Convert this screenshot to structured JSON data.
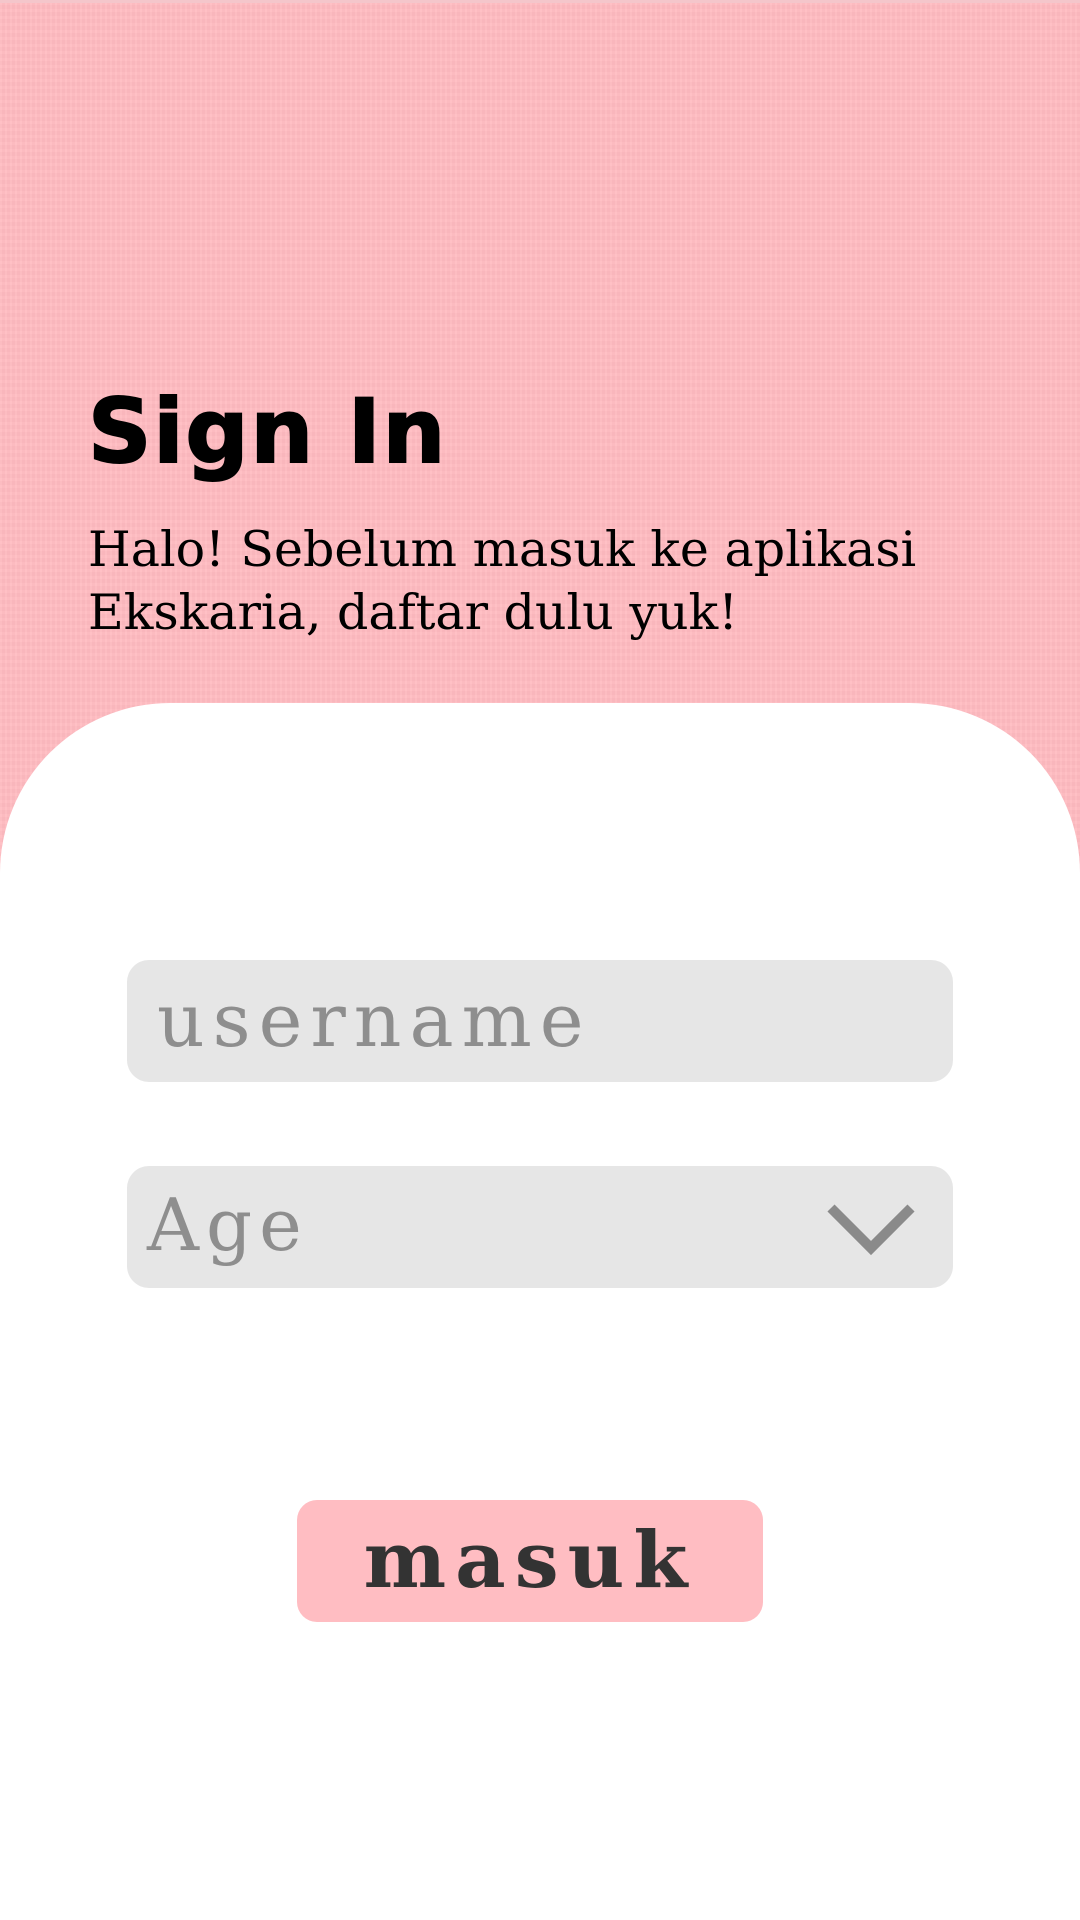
{
  "header": {
    "title": "Sign In",
    "subtitle": "Halo! Sebelum masuk ke aplikasi Ekskaria, daftar dulu yuk!"
  },
  "form": {
    "username": {
      "placeholder": "username",
      "value": ""
    },
    "age": {
      "selected_label": "Age",
      "icon": "chevron-down-icon"
    },
    "submit_label": "masuk"
  },
  "colors": {
    "header_background": "#ffbac0",
    "card_background": "#ffffff",
    "field_background": "#e6e6e6",
    "placeholder_text": "#8e8e8e",
    "button_background": "#ffbdc2",
    "button_text": "#333333"
  }
}
